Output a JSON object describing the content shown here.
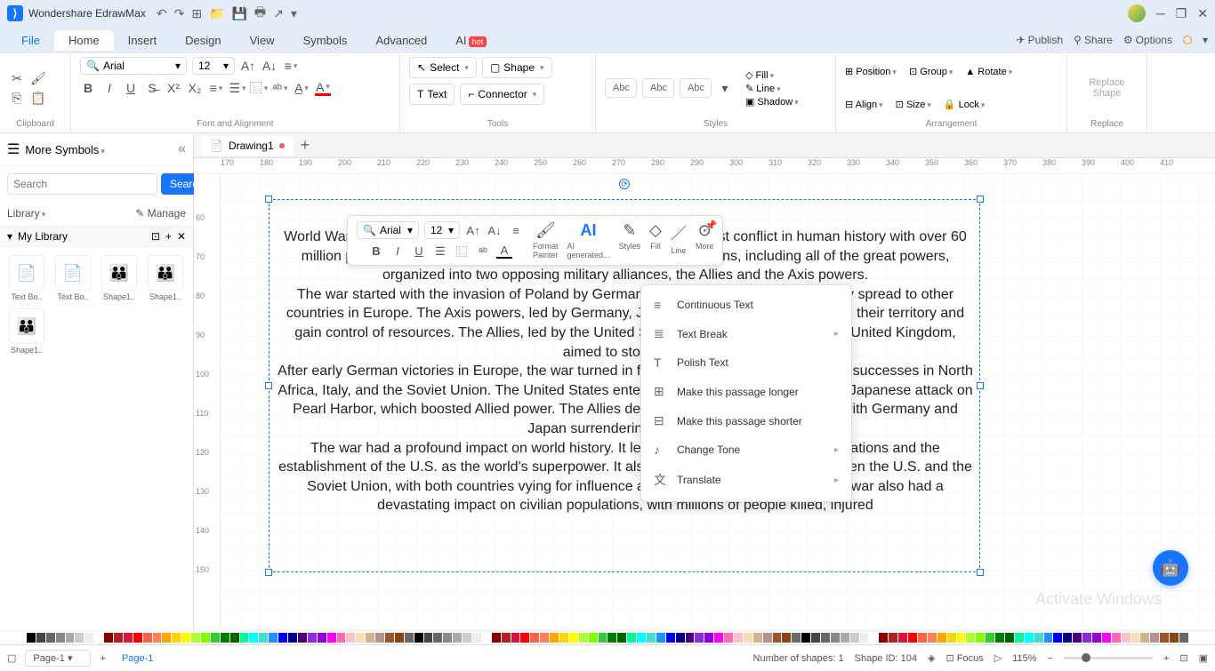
{
  "titlebar": {
    "app": "Wondershare EdrawMax"
  },
  "menu": {
    "file": "File",
    "home": "Home",
    "insert": "Insert",
    "design": "Design",
    "view": "View",
    "symbols": "Symbols",
    "advanced": "Advanced",
    "ai": "AI",
    "ai_badge": "hot",
    "publish": "Publish",
    "share": "Share",
    "options": "Options"
  },
  "ribbon": {
    "clipboard": "Clipboard",
    "font_align": "Font and Alignment",
    "tools": "Tools",
    "styles": "Styles",
    "arrangement": "Arrangement",
    "replace": "Replace",
    "font": "Arial",
    "size": "12",
    "select": "Select",
    "shape": "Shape",
    "text": "Text",
    "connector": "Connector",
    "abc": "Abc",
    "fill": "Fill",
    "line": "Line",
    "shadow": "Shadow",
    "position": "Position",
    "align": "Align",
    "group": "Group",
    "size_l": "Size",
    "rotate": "Rotate",
    "lock": "Lock",
    "replace_shape": "Replace\nShape"
  },
  "sidebar": {
    "more": "More Symbols",
    "search_ph": "Search",
    "search_btn": "Search",
    "library": "Library",
    "manage": "Manage",
    "mylib": "My Library",
    "shapes": [
      "Text Bo..",
      "Text Bo..",
      "Shape1..",
      "Shape1..",
      "Shape1.."
    ]
  },
  "tabs": {
    "drawing": "Drawing1"
  },
  "ruler_h": [
    "170",
    "180",
    "190",
    "200",
    "210",
    "220",
    "230",
    "240",
    "250",
    "260",
    "270",
    "280",
    "290",
    "300",
    "310",
    "320",
    "330",
    "340",
    "350",
    "360",
    "370",
    "380",
    "390",
    "400",
    "410"
  ],
  "ruler_v": [
    "",
    "60",
    "70",
    "80",
    "90",
    "100",
    "110",
    "120",
    "130",
    "140",
    "150"
  ],
  "text": {
    "p1": "World War II, which lasted from 1939 to 1945, was one of the deadliest conflict in human history with over 60 million people losing their lives. It involved most of the world's nations, including all of the great powers, organized into two opposing military alliances, the Allies and the Axis powers.",
    "p2": "The war started with the invasion of Poland by Germany in September 1939, and quickly spread to other countries in Europe. The Axis powers, led by Germany, Japan, and Italy, sought to expand their territory and gain control of resources. The Allies, led by the United States, the Soviet Union, and the United Kingdom, aimed to stop them.",
    "p3": "After early German victories in Europe, the war turned in favor of the Allies, thanks to Allied successes in North Africa, Italy, and the Soviet Union. The United States entered the war in 1941 following the Japanese attack on Pearl Harbor, which boosted Allied power. The Allies defeated the Axis powers in 1945, with Germany and Japan surrendering separately.",
    "p4": "The war had a profound impact on world history. It led to the formation of the United Nations and the establishment of the U.S. as the world's superpower. It also resulted in the Cold War between the U.S. and the Soviet Union, with both countries vying for influence and control across the world. The war also had a devastating impact on civilian populations, with millions of people killed, injured"
  },
  "float": {
    "font": "Arial",
    "size": "12",
    "format_painter": "Format\nPainter",
    "ai": "AI\ngenerated...",
    "styles": "Styles",
    "fill": "Fill",
    "line": "Line",
    "more": "More"
  },
  "ai_menu": {
    "continuous": "Continuous Text",
    "break": "Text Break",
    "polish": "Polish Text",
    "longer": "Make this passage longer",
    "shorter": "Make this passage shorter",
    "tone": "Change Tone",
    "translate": "Translate"
  },
  "status": {
    "page_sel": "Page-1",
    "page_tab": "Page-1",
    "shapes": "Number of shapes: 1",
    "shape_id": "Shape ID: 104",
    "focus": "Focus",
    "zoom": "115%"
  },
  "watermark": "Activate Windows",
  "colors": [
    "#000",
    "#444",
    "#666",
    "#888",
    "#aaa",
    "#ccc",
    "#eee",
    "#fff",
    "#8b0000",
    "#b22222",
    "#dc143c",
    "#ff0000",
    "#ff6347",
    "#ff7f50",
    "#ffa500",
    "#ffd700",
    "#ffff00",
    "#adff2f",
    "#7fff00",
    "#32cd32",
    "#008000",
    "#006400",
    "#00fa9a",
    "#00ffff",
    "#40e0d0",
    "#1e90ff",
    "#0000ff",
    "#00008b",
    "#4b0082",
    "#8a2be2",
    "#9400d3",
    "#ff00ff",
    "#ff69b4",
    "#ffc0cb",
    "#f5deb3",
    "#d2b48c",
    "#bc8f8f",
    "#a0522d",
    "#8b4513",
    "#696969"
  ]
}
